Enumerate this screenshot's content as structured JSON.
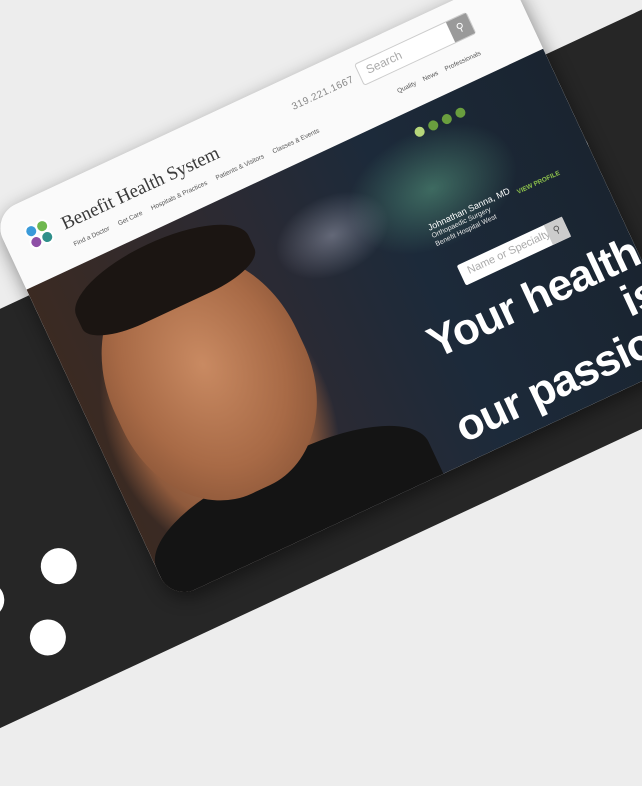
{
  "header": {
    "logo_text": "Benefit Health System",
    "logo_colors": [
      "#3a9ad9",
      "#6fb84f",
      "#8e4fa6",
      "#2f8f8a"
    ],
    "nav": [
      "Find a Doctor",
      "Get Care",
      "Hospitals & Practices",
      "Patients & Visitors",
      "Classes & Events"
    ],
    "phone": "319.221.1667",
    "search_placeholder": "Search",
    "utility": [
      "Quality",
      "News",
      "Professionals"
    ]
  },
  "hero": {
    "doctor_name": "Johnathan Sanna, MD",
    "doctor_specialty": "Orthopaedic Surgery",
    "doctor_location": "Benefit Hospital West",
    "view_profile": "VIEW PROFILE",
    "search_placeholder": "Name or Specialty",
    "tagline_line1": "Your health is",
    "tagline_line2": "our passion",
    "carousel_count": 4,
    "carousel_active": 1,
    "accent_color": "#6a9e3e"
  },
  "icons": {
    "search": "search-icon"
  }
}
